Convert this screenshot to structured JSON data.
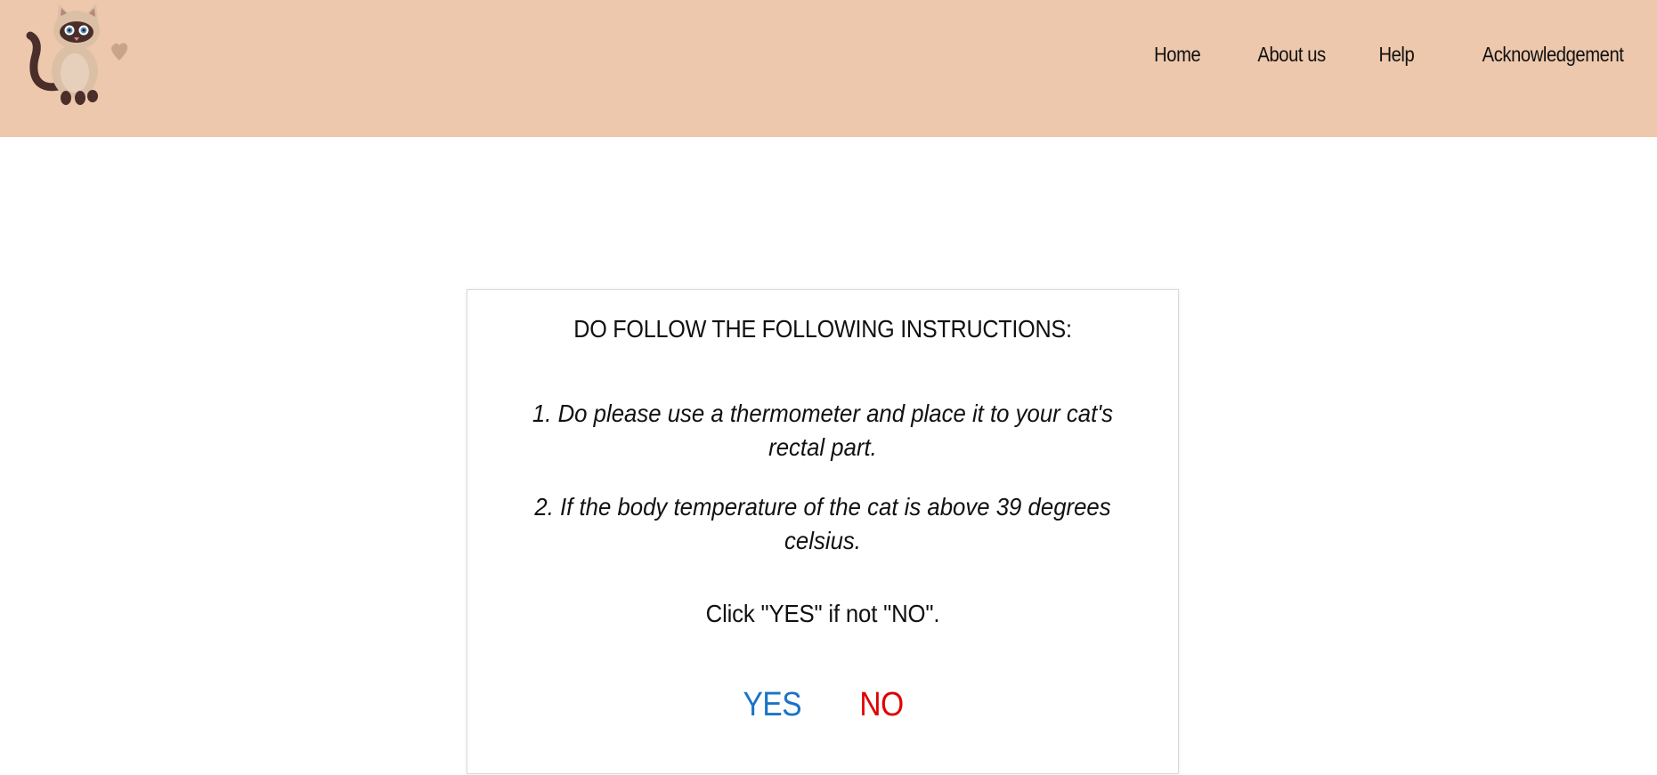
{
  "header": {
    "logo_icon": "cat-with-heart-logo",
    "background_color": "#edc8ad"
  },
  "nav": {
    "items": [
      {
        "label": "Home"
      },
      {
        "label": "About us"
      },
      {
        "label": "Help"
      },
      {
        "label": "Acknowledgement"
      }
    ]
  },
  "card": {
    "title": "DO FOLLOW THE FOLLOWING INSTRUCTIONS:",
    "instructions": [
      "1. Do please use a thermometer and place it to your cat's rectal part.",
      "2. If the body temperature of the cat is above 39 degrees celsius."
    ],
    "prompt": "Click \"YES\" if not \"NO\".",
    "yes_label": "YES",
    "no_label": "NO",
    "yes_color": "#1a73c7",
    "no_color": "#e00000"
  }
}
